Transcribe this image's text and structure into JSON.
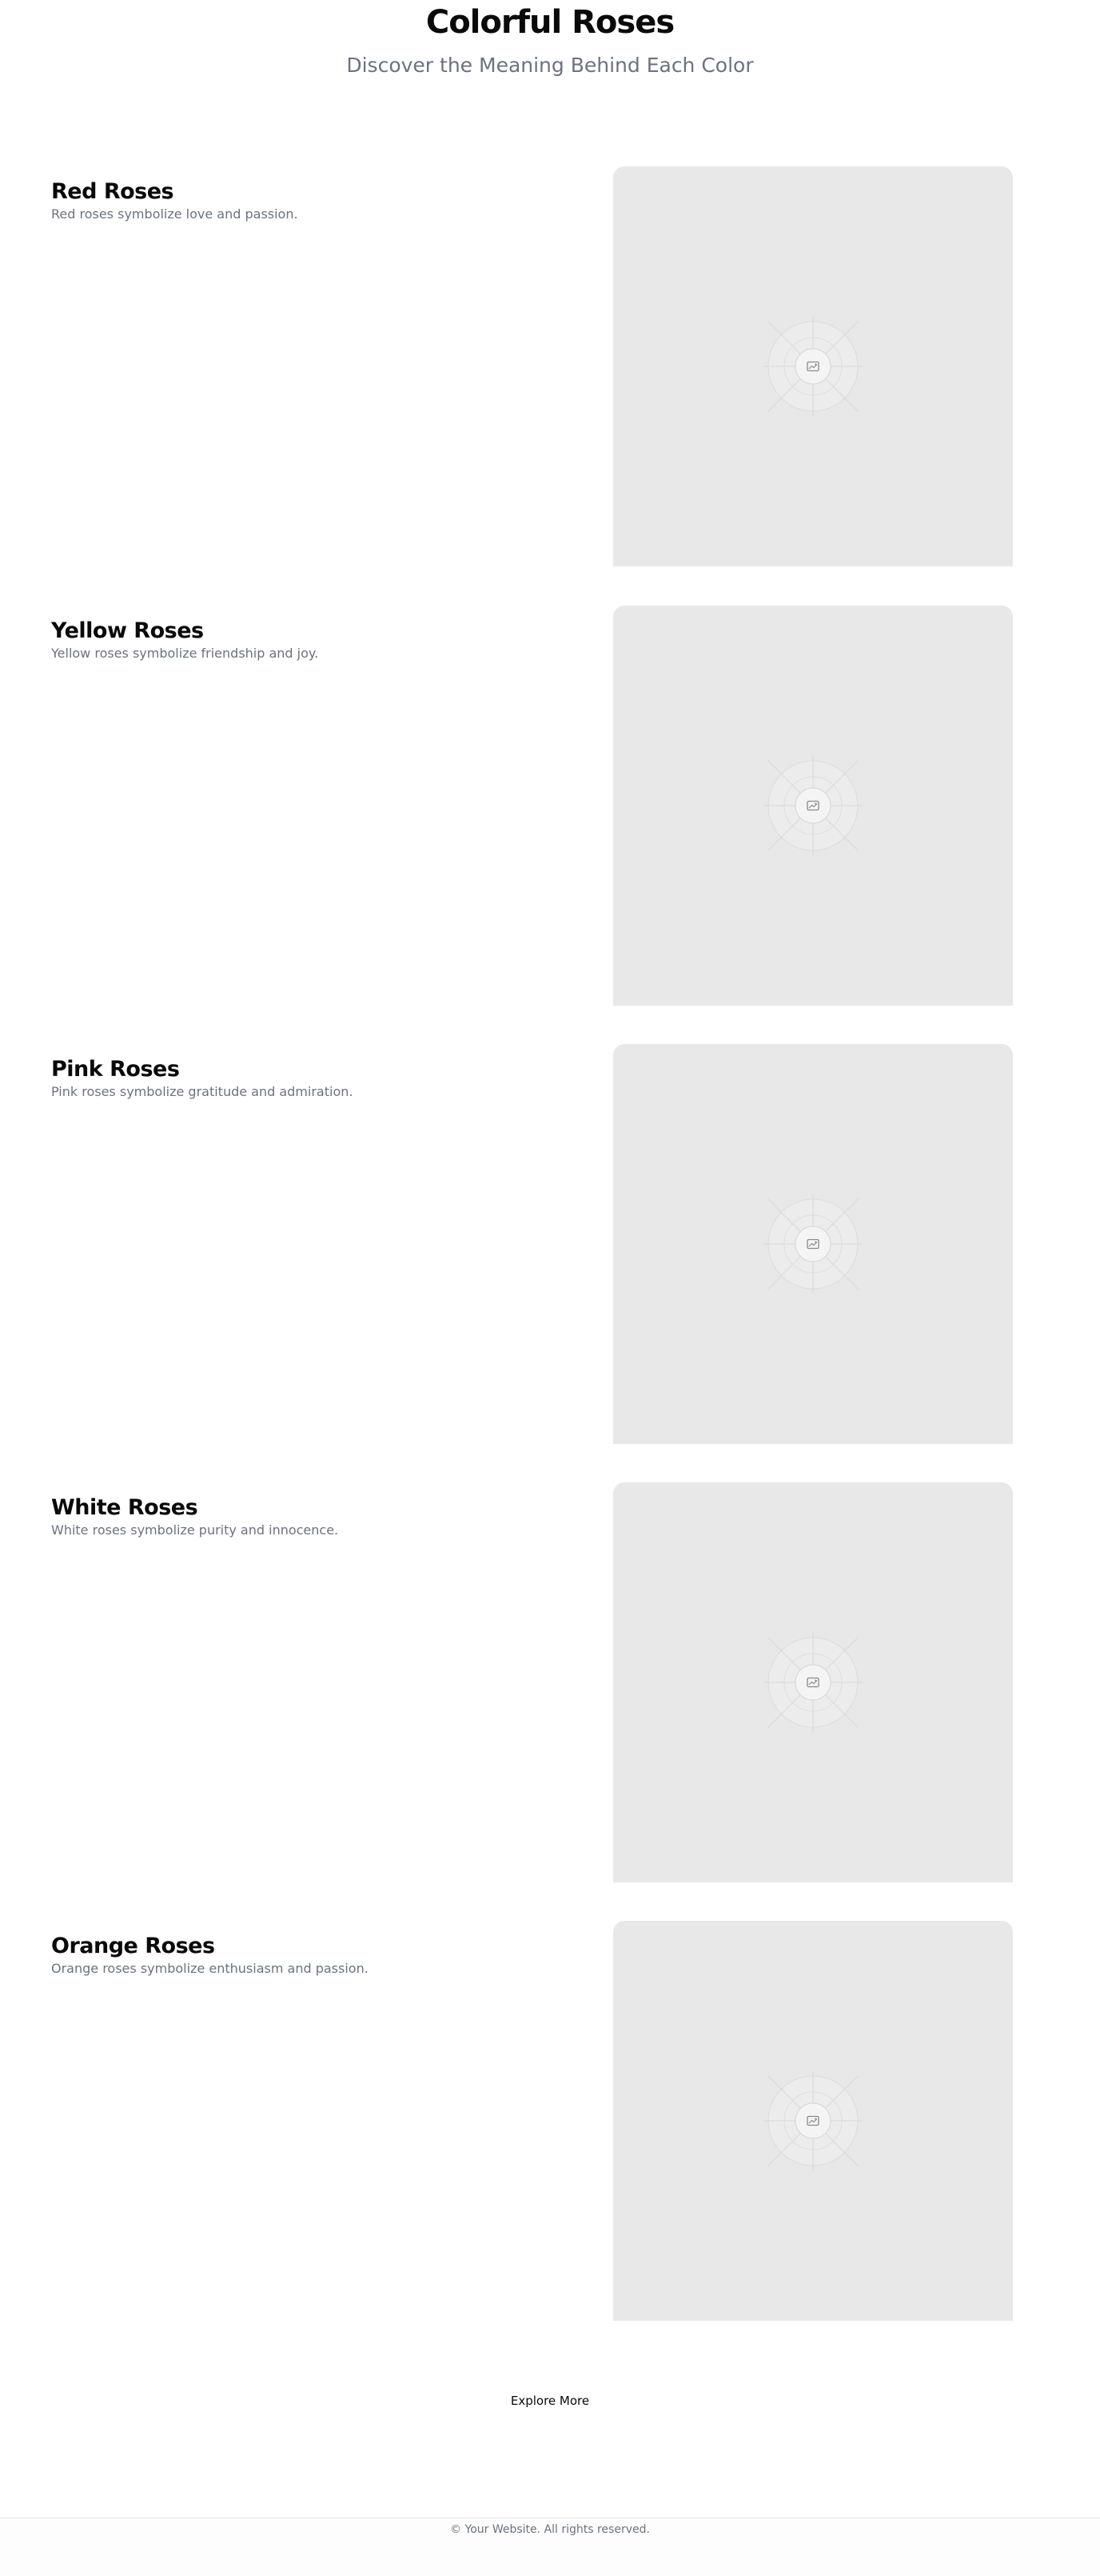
{
  "hero": {
    "title": "Colorful Roses",
    "subtitle": "Discover the Meaning Behind Each Color"
  },
  "sections": [
    {
      "title": "Red Roses",
      "description": "Red roses symbolize love and passion.",
      "image_icon": "image-placeholder-icon"
    },
    {
      "title": "Yellow Roses",
      "description": "Yellow roses symbolize friendship and joy.",
      "image_icon": "image-placeholder-icon"
    },
    {
      "title": "Pink Roses",
      "description": "Pink roses symbolize gratitude and admiration.",
      "image_icon": "image-placeholder-icon"
    },
    {
      "title": "White Roses",
      "description": "White roses symbolize purity and innocence.",
      "image_icon": "image-placeholder-icon"
    },
    {
      "title": "Orange Roses",
      "description": "Orange roses symbolize enthusiasm and passion.",
      "image_icon": "image-placeholder-icon"
    }
  ],
  "cta": {
    "label": "Explore More"
  },
  "footer": {
    "text": "© Your Website. All rights reserved."
  },
  "colors": {
    "heading": "#0a0a0a",
    "muted_text": "#6b7280",
    "placeholder_bg": "#e8e8e8",
    "divider": "#e5e7eb"
  }
}
